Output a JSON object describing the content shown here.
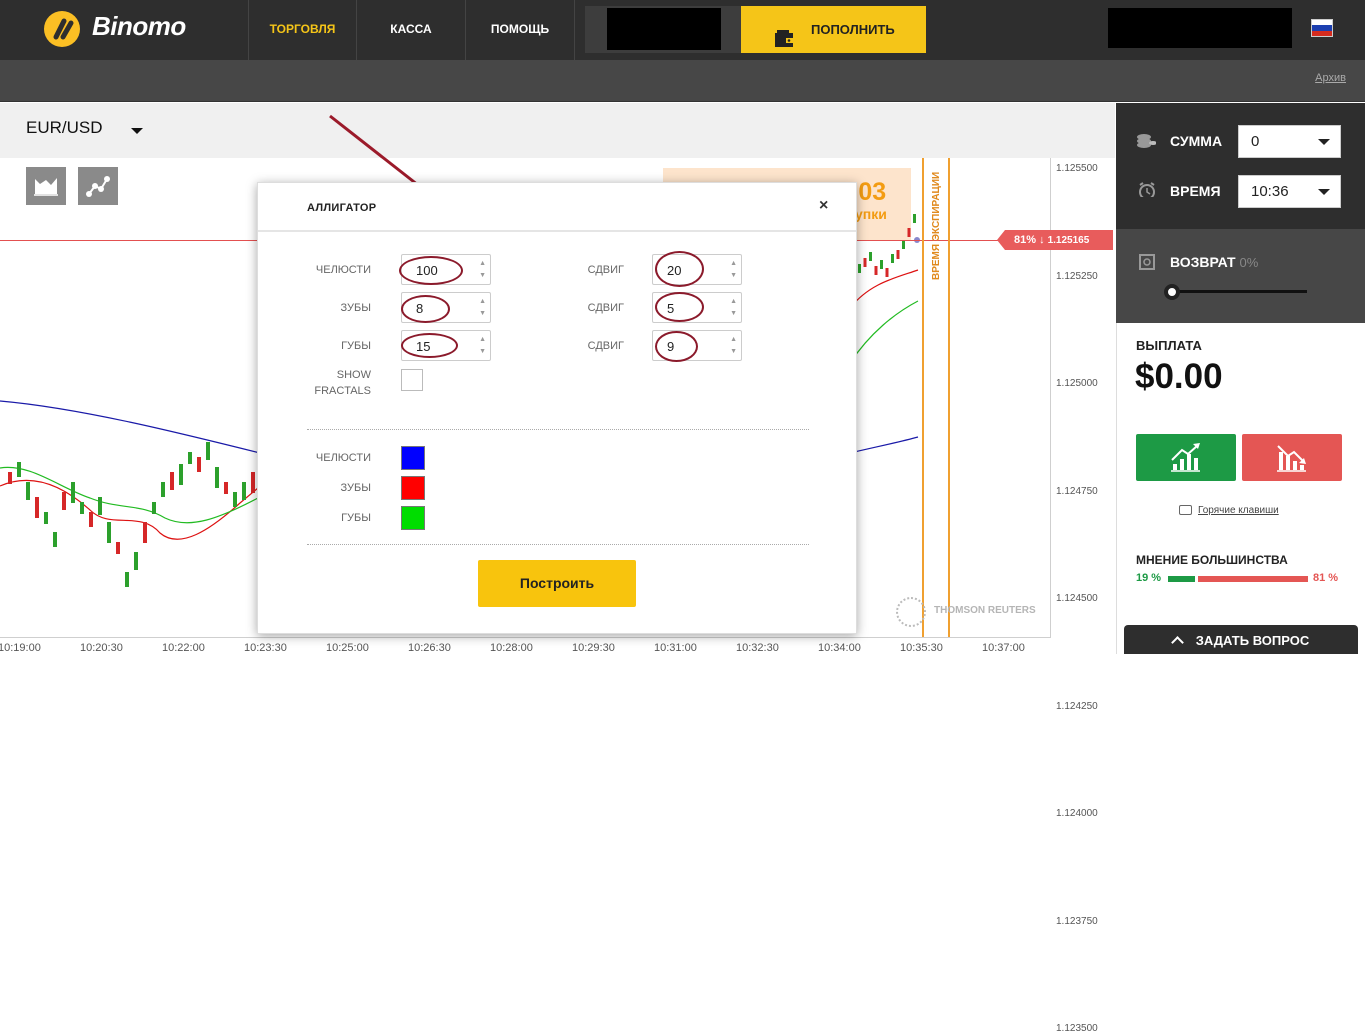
{
  "app": {
    "logo_text": "Binomo"
  },
  "nav": {
    "items": [
      {
        "label": "ТОРГОВЛЯ",
        "active": true
      },
      {
        "label": "КАССА",
        "active": false
      },
      {
        "label": "ПОМОЩЬ",
        "active": false
      }
    ]
  },
  "deposit": {
    "label": "ПОПОЛНИТЬ",
    "icon": "wallet-icon"
  },
  "subbar": {
    "archive_link": "Архив"
  },
  "chart": {
    "pair": "EUR/USD",
    "y_ticks": [
      "1.125500",
      "1.125250",
      "1.125000",
      "1.124750",
      "1.124500",
      "1.124250",
      "1.124000",
      "1.123750",
      "1.123500"
    ],
    "x_ticks": [
      "10:19:00",
      "10:20:30",
      "10:22:00",
      "10:23:30",
      "10:25:00",
      "10:26:30",
      "10:28:00",
      "10:29:30",
      "10:31:00",
      "10:32:30",
      "10:34:00",
      "10:35:30",
      "10:37:00"
    ],
    "price_tag": {
      "pct": "81% ↓",
      "value": "1.125165"
    },
    "timer": {
      "value": ":03",
      "sub": "упки"
    },
    "expiration_label": "ВРЕМЯ ЭКСПИРАЦИИ",
    "provider": "THOMSON REUTERS",
    "colors": {
      "jaws": "#1a1aa8",
      "teeth": "#dd1111",
      "lips": "#22bb22",
      "price_line": "#e35050"
    }
  },
  "modal": {
    "title": "АЛЛИГАТОР",
    "close": "×",
    "rows": [
      {
        "label": "ЧЕЛЮСТИ",
        "value": "100",
        "shift_label": "СДВИГ",
        "shift_value": "20"
      },
      {
        "label": "ЗУБЫ",
        "value": "8",
        "shift_label": "СДВИГ",
        "shift_value": "5"
      },
      {
        "label": "ГУБЫ",
        "value": "15",
        "shift_label": "СДВИГ",
        "shift_value": "9"
      }
    ],
    "fractals_label_1": "SHOW",
    "fractals_label_2": "FRACTALS",
    "color_rows": [
      {
        "label": "ЧЕЛЮСТИ",
        "color": "#0000ff"
      },
      {
        "label": "ЗУБЫ",
        "color": "#ff0000"
      },
      {
        "label": "ГУБЫ",
        "color": "#00dd00"
      }
    ],
    "build_button": "Построить"
  },
  "panel": {
    "amount_label": "СУММА",
    "amount_value": "0",
    "time_label": "ВРЕМЯ",
    "time_value": "10:36",
    "return_label": "ВОЗВРАТ",
    "return_pct": "0%",
    "payout_label": "ВЫПЛАТА",
    "payout_value": "$0.00",
    "hotkeys": "Горячие клавиши",
    "majority_label": "МНЕНИЕ БОЛЬШИНСТВА",
    "majority_up": "19 %",
    "majority_down": "81 %",
    "majority_up_fraction": 0.19,
    "ask_button": "ЗАДАТЬ ВОПРОС"
  }
}
